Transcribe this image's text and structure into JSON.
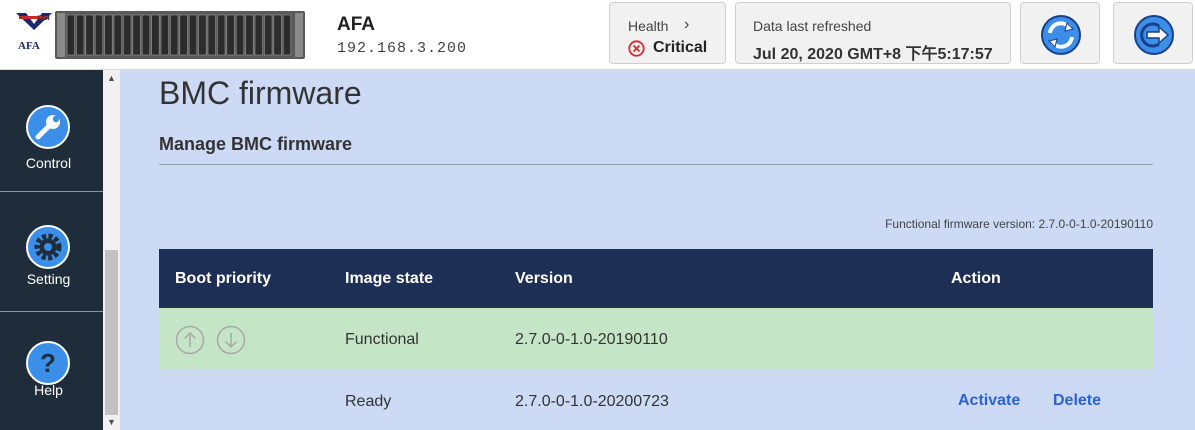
{
  "header": {
    "logo_text": "AFA",
    "app_name": "AFA",
    "ip_address": "192.168.3.200",
    "health": {
      "label": "Health",
      "status": "Critical"
    },
    "refresh": {
      "label": "Data last refreshed",
      "timestamp": "Jul 20, 2020 GMT+8 下午5:17:57"
    }
  },
  "sidebar": {
    "items": [
      {
        "label": "Control",
        "icon": "wrench-icon"
      },
      {
        "label": "Setting",
        "icon": "gear-icon"
      },
      {
        "label": "Help",
        "icon": "question-icon"
      }
    ]
  },
  "main": {
    "page_title": "BMC firmware",
    "section_title": "Manage BMC firmware",
    "functional_version": "Functional firmware version: 2.7.0-0-1.0-20190110",
    "table": {
      "columns": [
        "Boot priority",
        "Image state",
        "Version",
        "Action"
      ],
      "rows": [
        {
          "image_state": "Functional",
          "version": "2.7.0-0-1.0-20190110",
          "actions": []
        },
        {
          "image_state": "Ready",
          "version": "2.7.0-0-1.0-20200723",
          "actions": [
            "Activate",
            "Delete"
          ]
        }
      ]
    }
  },
  "colors": {
    "sidebar_bg": "#1f2d3b",
    "main_bg": "#ccdaf6",
    "table_header_bg": "#1e2f55",
    "functional_row_bg": "#c5e6c6",
    "link": "#2b62d6",
    "critical": "#d32f2f",
    "icon_blue": "#3b8fe8"
  }
}
